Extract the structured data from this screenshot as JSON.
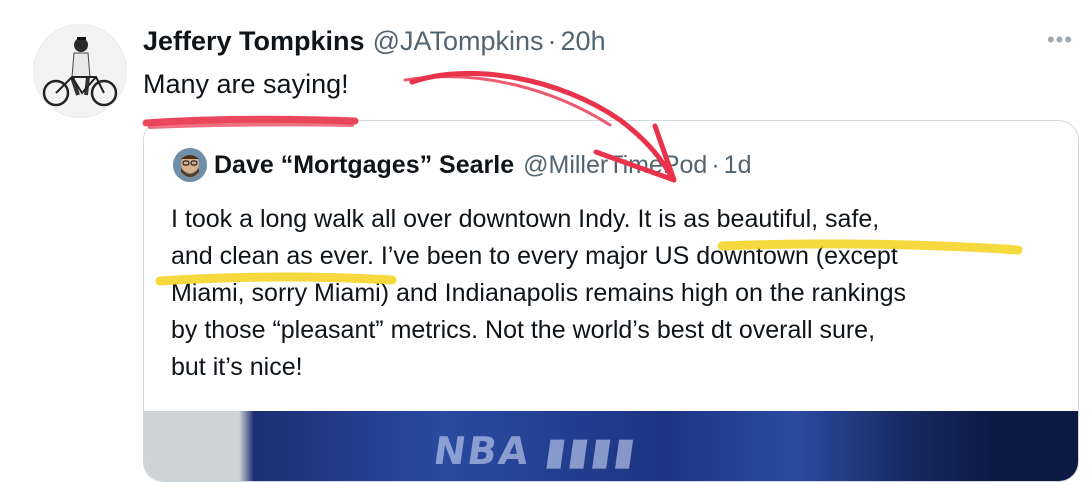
{
  "tweet": {
    "author_name": "Jeffery Tompkins",
    "author_handle": "@JATompkins",
    "separator": "·",
    "time": "20h",
    "text": "Many are saying!",
    "more_icon": "more-horizontal-icon"
  },
  "quoted_tweet": {
    "author_name": "Dave “Mortgages” Searle",
    "author_handle": "@MillerTimePod",
    "separator": "·",
    "time": "1d",
    "text_lines": [
      "I took a long walk all over downtown Indy. It is as beautiful, safe,",
      "and clean as ever. I’ve been to every major US downtown (except",
      "Miami, sorry Miami) and Indianapolis remains high on the rankings",
      "by those “pleasant” metrics. Not the world’s best dt overall sure,",
      "but it’s nice!"
    ]
  },
  "annotations": {
    "underline_color": "#e8334a",
    "arrow_color": "#e8334a",
    "highlight_color": "#f3d21c"
  }
}
